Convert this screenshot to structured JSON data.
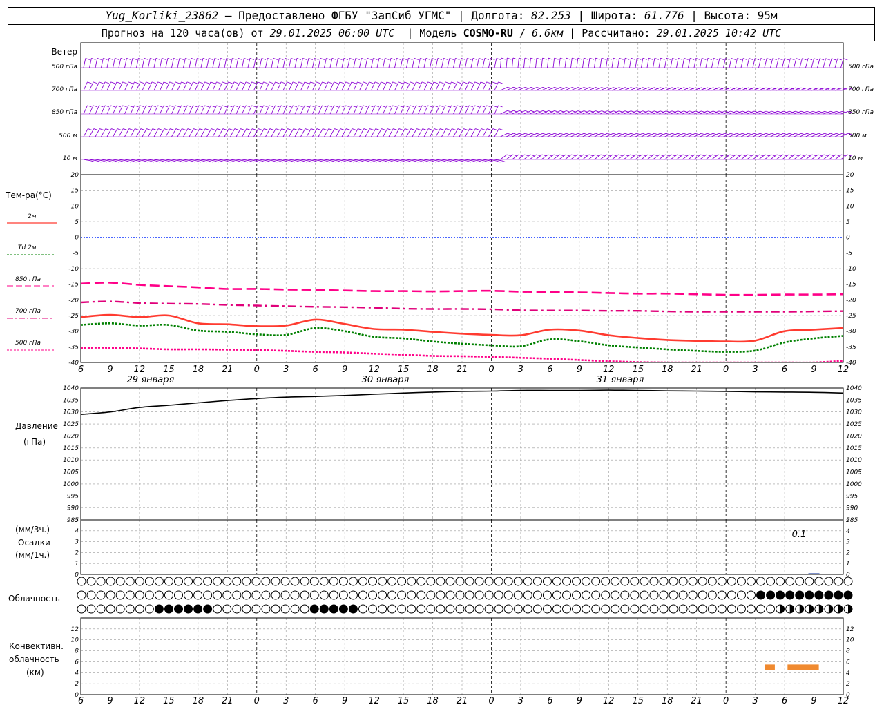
{
  "header": {
    "station": "Yug_Korliki_23862",
    "provided_by": "– Предоставлено ФГБУ \"ЗапСиб УГМС\"",
    "lon_label": "Долгота:",
    "lon": "82.253",
    "lat_label": "Широта:",
    "lat": "61.776",
    "alt_label": "Высота:",
    "alt": "95м",
    "forecast_label": "Прогноз на 120 часа(ов) от",
    "forecast_from": "29.01.2025 06:00 UTC",
    "model_label": "Модель",
    "model": "COSMO-RU",
    "resolution": "6.6км",
    "computed_label": "Рассчитано:",
    "computed": "29.01.2025 10:42 UTC"
  },
  "wind": {
    "title": "Ветер",
    "levels": [
      "500 гПа",
      "700 гПа",
      "850 гПа",
      "500 м",
      "10  м"
    ]
  },
  "temperature": {
    "title": "Тем-ра(°C)",
    "legend": [
      "2м",
      "Td  2м",
      "850 гПа",
      "700 гПа",
      "500 гПа"
    ],
    "ticks": [
      "20",
      "15",
      "10",
      "5",
      "0",
      "-5",
      "-10",
      "-15",
      "-20",
      "-25",
      "-30",
      "-35",
      "-40"
    ]
  },
  "pressure": {
    "title": "Давление",
    "unit": "(гПа)",
    "ticks": [
      "1040",
      "1035",
      "1030",
      "1025",
      "1020",
      "1015",
      "1010",
      "1005",
      "1000",
      "995",
      "990",
      "985"
    ]
  },
  "precip": {
    "unit_top": "(мм/3ч.)",
    "title": "Осадки",
    "unit_bottom": "(мм/1ч.)",
    "ticks": [
      "5",
      "4",
      "3",
      "2",
      "1",
      "0"
    ],
    "annotation": "0.1"
  },
  "cloud": {
    "title": "Облачность"
  },
  "conv": {
    "title1": "Конвективн.",
    "title2": "облачность",
    "unit": "(км)",
    "ticks": [
      "12",
      "10",
      "8",
      "6",
      "4",
      "2",
      "0"
    ]
  },
  "x_axis": {
    "hour_labels": [
      "6",
      "9",
      "12",
      "15",
      "18",
      "21",
      "0",
      "3",
      "6",
      "9",
      "12",
      "15",
      "18",
      "21",
      "0",
      "3",
      "6",
      "9",
      "12",
      "15",
      "18",
      "21",
      "0",
      "3",
      "6",
      "9",
      "12"
    ],
    "dates": [
      "29 января",
      "30 января",
      "31 января"
    ]
  },
  "colors": {
    "t2m": "#ff3b30",
    "td2m": "#008000",
    "t850": "#ff0088",
    "t700": "#e0007a",
    "t500": "#ff0088",
    "wind": "#8a00d4",
    "conv": "#f08a30",
    "zero_line": "#3050ff"
  },
  "chart_data": {
    "type": "line",
    "x_hours_from_start": [
      0,
      3,
      6,
      9,
      12,
      15,
      18,
      21,
      24,
      27,
      30,
      33,
      36,
      39,
      42,
      45,
      48,
      51,
      54,
      57,
      60,
      63,
      66,
      69,
      72,
      75,
      78
    ],
    "x_tick_labels": [
      "6",
      "9",
      "12",
      "15",
      "18",
      "21",
      "0",
      "3",
      "6",
      "9",
      "12",
      "15",
      "18",
      "21",
      "0",
      "3",
      "6",
      "9",
      "12",
      "15",
      "18",
      "21",
      "0",
      "3",
      "6",
      "9",
      "12"
    ],
    "temperature": {
      "ylabel": "Тем-ра(°C)",
      "ylim": [
        -40,
        20
      ],
      "series": [
        {
          "name": "2м",
          "values": [
            -25.5,
            -24.8,
            -25.5,
            -25.0,
            -27.5,
            -27.8,
            -28.4,
            -28.2,
            -26.3,
            -27.7,
            -29.3,
            -29.5,
            -30.2,
            -30.8,
            -31.2,
            -31.3,
            -29.5,
            -29.8,
            -31.3,
            -32.2,
            -32.8,
            -33.1,
            -33.3,
            -33.0,
            -30.0,
            -29.5,
            -29.0
          ]
        },
        {
          "name": "Td  2м",
          "values": [
            -28.0,
            -27.5,
            -28.2,
            -28.0,
            -29.8,
            -30.2,
            -31.0,
            -31.2,
            -29.0,
            -30.0,
            -31.8,
            -32.3,
            -33.3,
            -34.0,
            -34.5,
            -34.8,
            -32.6,
            -33.2,
            -34.5,
            -35.2,
            -35.8,
            -36.3,
            -36.6,
            -36.2,
            -33.6,
            -32.3,
            -31.5
          ]
        },
        {
          "name": "850 гПа",
          "values": [
            -14.8,
            -14.5,
            -15.2,
            -15.6,
            -16.0,
            -16.5,
            -16.5,
            -16.7,
            -16.8,
            -17.0,
            -17.2,
            -17.2,
            -17.3,
            -17.2,
            -17.1,
            -17.4,
            -17.5,
            -17.6,
            -17.8,
            -18.0,
            -18.0,
            -18.2,
            -18.4,
            -18.4,
            -18.3,
            -18.3,
            -18.2
          ]
        },
        {
          "name": "700 гПа",
          "values": [
            -20.8,
            -20.5,
            -21.0,
            -21.2,
            -21.3,
            -21.6,
            -21.8,
            -22.0,
            -22.2,
            -22.3,
            -22.5,
            -22.8,
            -22.9,
            -22.9,
            -23.0,
            -23.3,
            -23.4,
            -23.4,
            -23.5,
            -23.5,
            -23.7,
            -23.8,
            -23.8,
            -23.8,
            -23.8,
            -23.7,
            -23.6
          ]
        },
        {
          "name": "500 гПа",
          "values": [
            -35.3,
            -35.3,
            -35.5,
            -35.8,
            -35.8,
            -35.9,
            -36.0,
            -36.3,
            -36.6,
            -36.8,
            -37.2,
            -37.5,
            -37.9,
            -38.0,
            -38.2,
            -38.5,
            -38.8,
            -39.2,
            -39.6,
            -39.9,
            -40.0,
            -40.0,
            -40.0,
            -40.0,
            -40.0,
            -40.0,
            -39.5
          ]
        }
      ]
    },
    "pressure": {
      "ylabel": "Давление",
      "ylim": [
        985,
        1040
      ],
      "values": [
        1029.0,
        1030.0,
        1031.9,
        1032.8,
        1033.8,
        1034.8,
        1035.6,
        1036.2,
        1036.5,
        1036.9,
        1037.4,
        1037.9,
        1038.3,
        1038.6,
        1038.7,
        1039.0,
        1039.0,
        1039.0,
        1039.1,
        1039.0,
        1038.8,
        1038.7,
        1038.6,
        1038.4,
        1038.3,
        1038.2,
        1037.9
      ]
    },
    "precipitation": {
      "ylabel": "Осадки",
      "ylim": [
        0,
        5
      ],
      "values": [
        0,
        0,
        0,
        0,
        0,
        0,
        0,
        0,
        0,
        0,
        0,
        0,
        0,
        0,
        0,
        0,
        0,
        0,
        0,
        0,
        0,
        0,
        0,
        0,
        0,
        0.1,
        0
      ]
    },
    "convective_cloud": {
      "ylabel": "Конвективн. облачность (км)",
      "ylim": [
        0,
        14
      ],
      "layers": [
        {
          "x_start": 70.0,
          "x_end": 71.0,
          "base_km": 4.5,
          "top_km": 5.5
        },
        {
          "x_start": 72.3,
          "x_end": 75.5,
          "base_km": 4.5,
          "top_km": 5.5
        }
      ]
    },
    "wind_levels": [
      "500 гПа",
      "700 гПа",
      "850 гПа",
      "500 м",
      "10  м"
    ]
  }
}
